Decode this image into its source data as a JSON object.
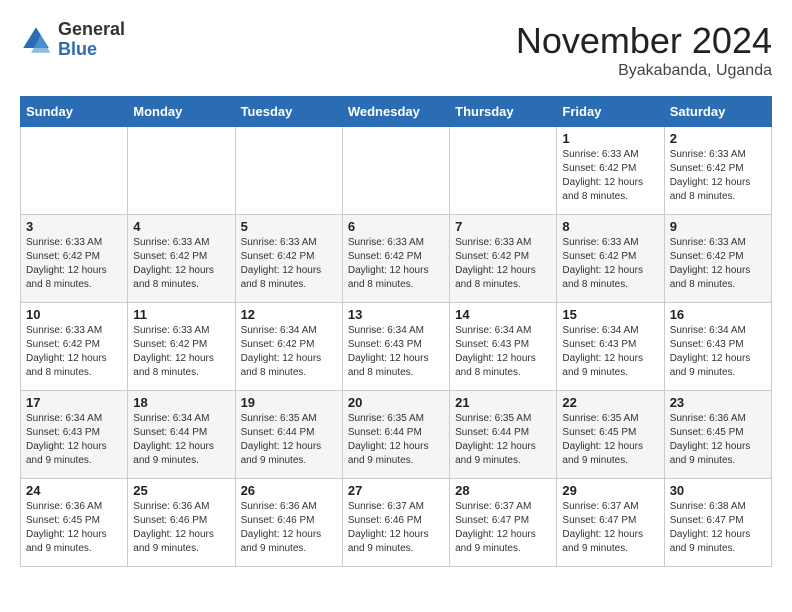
{
  "logo": {
    "general": "General",
    "blue": "Blue"
  },
  "title": "November 2024",
  "subtitle": "Byakabanda, Uganda",
  "days_of_week": [
    "Sunday",
    "Monday",
    "Tuesday",
    "Wednesday",
    "Thursday",
    "Friday",
    "Saturday"
  ],
  "weeks": [
    [
      {
        "day": "",
        "info": ""
      },
      {
        "day": "",
        "info": ""
      },
      {
        "day": "",
        "info": ""
      },
      {
        "day": "",
        "info": ""
      },
      {
        "day": "",
        "info": ""
      },
      {
        "day": "1",
        "info": "Sunrise: 6:33 AM\nSunset: 6:42 PM\nDaylight: 12 hours\nand 8 minutes."
      },
      {
        "day": "2",
        "info": "Sunrise: 6:33 AM\nSunset: 6:42 PM\nDaylight: 12 hours\nand 8 minutes."
      }
    ],
    [
      {
        "day": "3",
        "info": "Sunrise: 6:33 AM\nSunset: 6:42 PM\nDaylight: 12 hours\nand 8 minutes."
      },
      {
        "day": "4",
        "info": "Sunrise: 6:33 AM\nSunset: 6:42 PM\nDaylight: 12 hours\nand 8 minutes."
      },
      {
        "day": "5",
        "info": "Sunrise: 6:33 AM\nSunset: 6:42 PM\nDaylight: 12 hours\nand 8 minutes."
      },
      {
        "day": "6",
        "info": "Sunrise: 6:33 AM\nSunset: 6:42 PM\nDaylight: 12 hours\nand 8 minutes."
      },
      {
        "day": "7",
        "info": "Sunrise: 6:33 AM\nSunset: 6:42 PM\nDaylight: 12 hours\nand 8 minutes."
      },
      {
        "day": "8",
        "info": "Sunrise: 6:33 AM\nSunset: 6:42 PM\nDaylight: 12 hours\nand 8 minutes."
      },
      {
        "day": "9",
        "info": "Sunrise: 6:33 AM\nSunset: 6:42 PM\nDaylight: 12 hours\nand 8 minutes."
      }
    ],
    [
      {
        "day": "10",
        "info": "Sunrise: 6:33 AM\nSunset: 6:42 PM\nDaylight: 12 hours\nand 8 minutes."
      },
      {
        "day": "11",
        "info": "Sunrise: 6:33 AM\nSunset: 6:42 PM\nDaylight: 12 hours\nand 8 minutes."
      },
      {
        "day": "12",
        "info": "Sunrise: 6:34 AM\nSunset: 6:42 PM\nDaylight: 12 hours\nand 8 minutes."
      },
      {
        "day": "13",
        "info": "Sunrise: 6:34 AM\nSunset: 6:43 PM\nDaylight: 12 hours\nand 8 minutes."
      },
      {
        "day": "14",
        "info": "Sunrise: 6:34 AM\nSunset: 6:43 PM\nDaylight: 12 hours\nand 8 minutes."
      },
      {
        "day": "15",
        "info": "Sunrise: 6:34 AM\nSunset: 6:43 PM\nDaylight: 12 hours\nand 9 minutes."
      },
      {
        "day": "16",
        "info": "Sunrise: 6:34 AM\nSunset: 6:43 PM\nDaylight: 12 hours\nand 9 minutes."
      }
    ],
    [
      {
        "day": "17",
        "info": "Sunrise: 6:34 AM\nSunset: 6:43 PM\nDaylight: 12 hours\nand 9 minutes."
      },
      {
        "day": "18",
        "info": "Sunrise: 6:34 AM\nSunset: 6:44 PM\nDaylight: 12 hours\nand 9 minutes."
      },
      {
        "day": "19",
        "info": "Sunrise: 6:35 AM\nSunset: 6:44 PM\nDaylight: 12 hours\nand 9 minutes."
      },
      {
        "day": "20",
        "info": "Sunrise: 6:35 AM\nSunset: 6:44 PM\nDaylight: 12 hours\nand 9 minutes."
      },
      {
        "day": "21",
        "info": "Sunrise: 6:35 AM\nSunset: 6:44 PM\nDaylight: 12 hours\nand 9 minutes."
      },
      {
        "day": "22",
        "info": "Sunrise: 6:35 AM\nSunset: 6:45 PM\nDaylight: 12 hours\nand 9 minutes."
      },
      {
        "day": "23",
        "info": "Sunrise: 6:36 AM\nSunset: 6:45 PM\nDaylight: 12 hours\nand 9 minutes."
      }
    ],
    [
      {
        "day": "24",
        "info": "Sunrise: 6:36 AM\nSunset: 6:45 PM\nDaylight: 12 hours\nand 9 minutes."
      },
      {
        "day": "25",
        "info": "Sunrise: 6:36 AM\nSunset: 6:46 PM\nDaylight: 12 hours\nand 9 minutes."
      },
      {
        "day": "26",
        "info": "Sunrise: 6:36 AM\nSunset: 6:46 PM\nDaylight: 12 hours\nand 9 minutes."
      },
      {
        "day": "27",
        "info": "Sunrise: 6:37 AM\nSunset: 6:46 PM\nDaylight: 12 hours\nand 9 minutes."
      },
      {
        "day": "28",
        "info": "Sunrise: 6:37 AM\nSunset: 6:47 PM\nDaylight: 12 hours\nand 9 minutes."
      },
      {
        "day": "29",
        "info": "Sunrise: 6:37 AM\nSunset: 6:47 PM\nDaylight: 12 hours\nand 9 minutes."
      },
      {
        "day": "30",
        "info": "Sunrise: 6:38 AM\nSunset: 6:47 PM\nDaylight: 12 hours\nand 9 minutes."
      }
    ]
  ]
}
